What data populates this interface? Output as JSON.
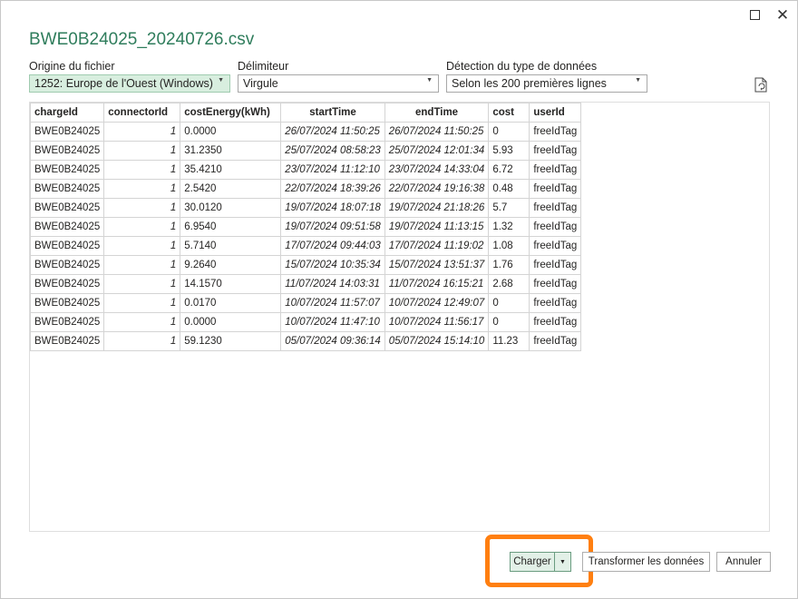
{
  "window": {
    "title": "BWE0B24025_20240726.csv"
  },
  "controls": {
    "origin": {
      "label": "Origine du fichier",
      "value": "1252: Europe de l'Ouest (Windows)"
    },
    "delimiter": {
      "label": "Délimiteur",
      "value": "Virgule"
    },
    "detection": {
      "label": "Détection du type de données",
      "value": "Selon les 200 premières lignes"
    }
  },
  "table": {
    "columns": [
      "chargeId",
      "connectorId",
      "costEnergy(kWh)",
      "startTime",
      "endTime",
      "cost",
      "userId"
    ],
    "rows": [
      [
        "BWE0B24025",
        "1",
        "0.0000",
        "26/07/2024 11:50:25",
        "26/07/2024 11:50:25",
        "0",
        "freeIdTag"
      ],
      [
        "BWE0B24025",
        "1",
        "31.2350",
        "25/07/2024 08:58:23",
        "25/07/2024 12:01:34",
        "5.93",
        "freeIdTag"
      ],
      [
        "BWE0B24025",
        "1",
        "35.4210",
        "23/07/2024 11:12:10",
        "23/07/2024 14:33:04",
        "6.72",
        "freeIdTag"
      ],
      [
        "BWE0B24025",
        "1",
        "2.5420",
        "22/07/2024 18:39:26",
        "22/07/2024 19:16:38",
        "0.48",
        "freeIdTag"
      ],
      [
        "BWE0B24025",
        "1",
        "30.0120",
        "19/07/2024 18:07:18",
        "19/07/2024 21:18:26",
        "5.7",
        "freeIdTag"
      ],
      [
        "BWE0B24025",
        "1",
        "6.9540",
        "19/07/2024 09:51:58",
        "19/07/2024 11:13:15",
        "1.32",
        "freeIdTag"
      ],
      [
        "BWE0B24025",
        "1",
        "5.7140",
        "17/07/2024 09:44:03",
        "17/07/2024 11:19:02",
        "1.08",
        "freeIdTag"
      ],
      [
        "BWE0B24025",
        "1",
        "9.2640",
        "15/07/2024 10:35:34",
        "15/07/2024 13:51:37",
        "1.76",
        "freeIdTag"
      ],
      [
        "BWE0B24025",
        "1",
        "14.1570",
        "11/07/2024 14:03:31",
        "11/07/2024 16:15:21",
        "2.68",
        "freeIdTag"
      ],
      [
        "BWE0B24025",
        "1",
        "0.0170",
        "10/07/2024 11:57:07",
        "10/07/2024 12:49:07",
        "0",
        "freeIdTag"
      ],
      [
        "BWE0B24025",
        "1",
        "0.0000",
        "10/07/2024 11:47:10",
        "10/07/2024 11:56:17",
        "0",
        "freeIdTag"
      ],
      [
        "BWE0B24025",
        "1",
        "59.1230",
        "05/07/2024 09:36:14",
        "05/07/2024 15:14:10",
        "11.23",
        "freeIdTag"
      ]
    ]
  },
  "buttons": {
    "charger": "Charger",
    "transform": "Transformer les données",
    "cancel": "Annuler"
  },
  "colors": {
    "title": "#2f7d5c",
    "highlight": "#ff7f10",
    "selected_bg": "#d8eedf"
  }
}
